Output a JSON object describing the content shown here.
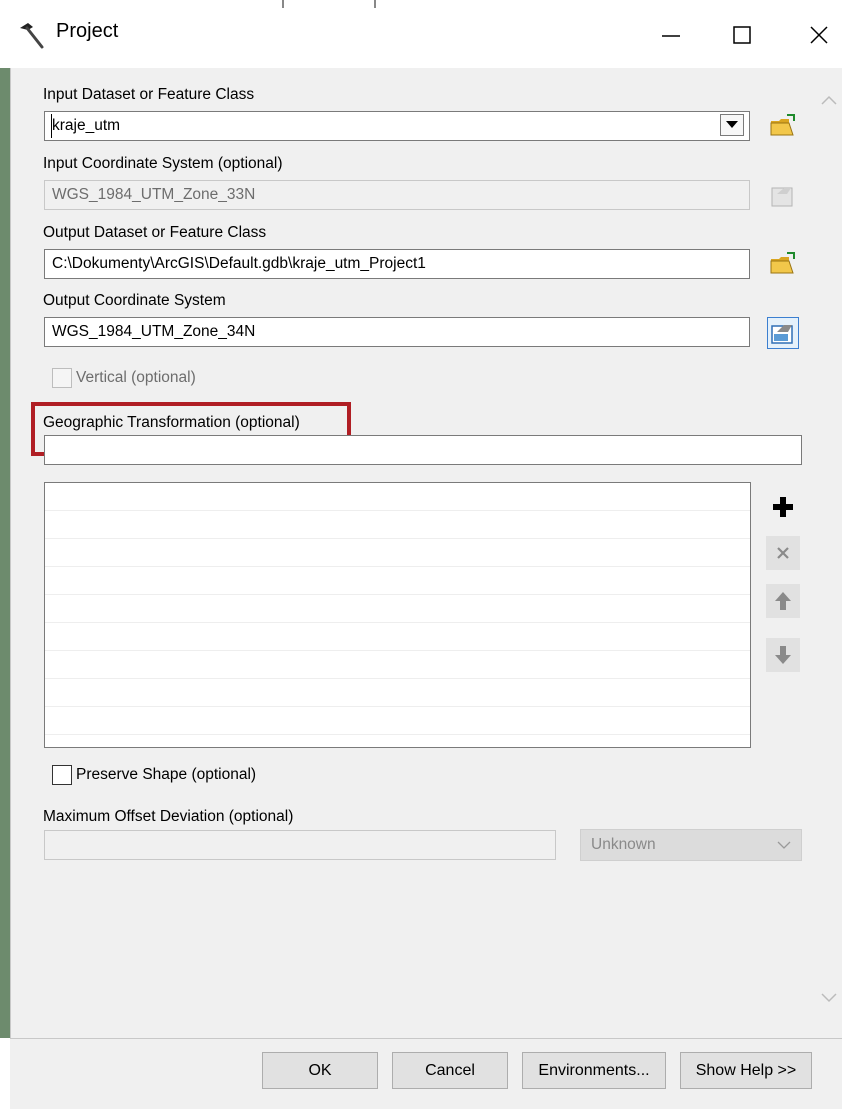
{
  "window": {
    "title": "Project",
    "title_icon": "hammer-icon",
    "controls": {
      "minimize": "minimize-icon",
      "maximize": "maximize-icon",
      "close": "close-icon"
    }
  },
  "form": {
    "input_dataset": {
      "label": "Input Dataset or Feature Class",
      "value": "kraje_utm"
    },
    "input_cs": {
      "label": "Input Coordinate System (optional)",
      "value": "WGS_1984_UTM_Zone_33N"
    },
    "output_dataset": {
      "label": "Output Dataset or Feature Class",
      "value": "C:\\Dokumenty\\ArcGIS\\Default.gdb\\kraje_utm_Project1"
    },
    "output_cs": {
      "label": "Output Coordinate System",
      "value": "WGS_1984_UTM_Zone_34N"
    },
    "vertical": {
      "label": "Vertical (optional)",
      "checked": false,
      "enabled": false
    },
    "geo_transform": {
      "label": "Geographic Transformation (optional)",
      "value": ""
    },
    "preserve_shape": {
      "label": "Preserve Shape (optional)",
      "checked": false
    },
    "max_offset": {
      "label": "Maximum Offset Deviation (optional)",
      "value": "",
      "unit": "Unknown"
    }
  },
  "buttons": {
    "ok": "OK",
    "cancel": "Cancel",
    "environments": "Environments...",
    "show_help": "Show Help >>"
  },
  "colors": {
    "highlight": "#b01e24",
    "folder": "#e8b83c",
    "panel": "#f0f0f0"
  }
}
